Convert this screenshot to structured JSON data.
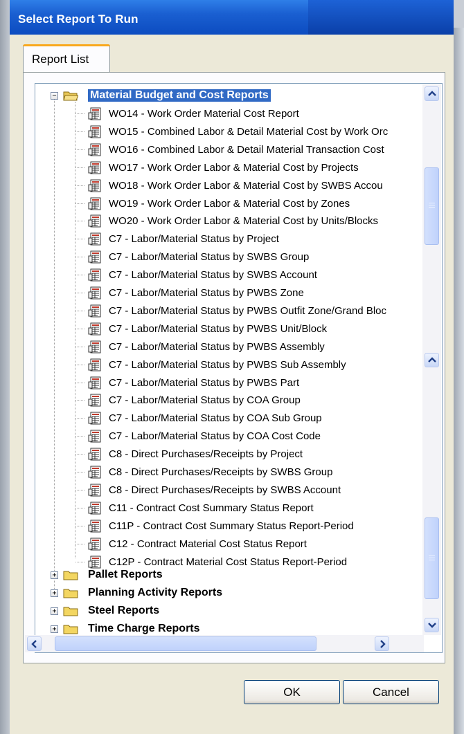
{
  "window": {
    "title": "Select Report To Run"
  },
  "tabs": [
    {
      "label": "Report List"
    }
  ],
  "tree": {
    "selected_folder": {
      "label": "Material Budget and Cost Reports",
      "expanded": true,
      "items": [
        "WO14 - Work Order Material Cost Report",
        "WO15 - Combined Labor & Detail Material Cost by Work Orc",
        "WO16 - Combined Labor & Detail Material Transaction Cost",
        "WO17 - Work Order Labor & Material Cost by Projects",
        "WO18 - Work Order Labor & Material Cost by SWBS Accou",
        "WO19 - Work Order Labor & Material Cost by Zones",
        "WO20 - Work Order Labor & Material Cost by Units/Blocks",
        "C7 - Labor/Material Status by Project",
        "C7 - Labor/Material Status by SWBS Group",
        "C7 - Labor/Material Status by SWBS Account",
        "C7 - Labor/Material Status by PWBS Zone",
        "C7 - Labor/Material Status by PWBS Outfit Zone/Grand Bloc",
        "C7 - Labor/Material Status by PWBS Unit/Block",
        "C7 - Labor/Material Status by PWBS Assembly",
        "C7 - Labor/Material Status by PWBS Sub Assembly",
        "C7 - Labor/Material Status by PWBS Part",
        "C7 - Labor/Material Status by COA Group",
        "C7 - Labor/Material Status by COA Sub Group",
        "C7 - Labor/Material Status by COA Cost Code",
        "C8 - Direct Purchases/Receipts by Project",
        "C8 - Direct Purchases/Receipts by SWBS Group",
        "C8 - Direct Purchases/Receipts by SWBS Account",
        "C11 - Contract Cost Summary Status Report",
        "C11P - Contract Cost Summary Status Report-Period",
        "C12 - Contract Material Cost Status Report",
        "C12P - Contract Material Cost Status Report-Period"
      ]
    },
    "collapsed_folders": [
      "Pallet Reports",
      "Planning Activity Reports",
      "Steel Reports",
      "Time Charge Reports"
    ],
    "expand_symbol": "+",
    "collapse_symbol": "−"
  },
  "buttons": {
    "ok": "OK",
    "cancel": "Cancel"
  },
  "icons": {
    "folder": "folder-icon",
    "folder_open": "folder-open-icon",
    "report": "report-icon",
    "scroll_up": "chevron-up-icon",
    "scroll_down": "chevron-down-icon",
    "scroll_left": "chevron-left-icon",
    "scroll_right": "chevron-right-icon"
  },
  "colors": {
    "titlebar": "#0c4cc0",
    "selection": "#316ac5",
    "tab_accent": "#f9a81c"
  }
}
